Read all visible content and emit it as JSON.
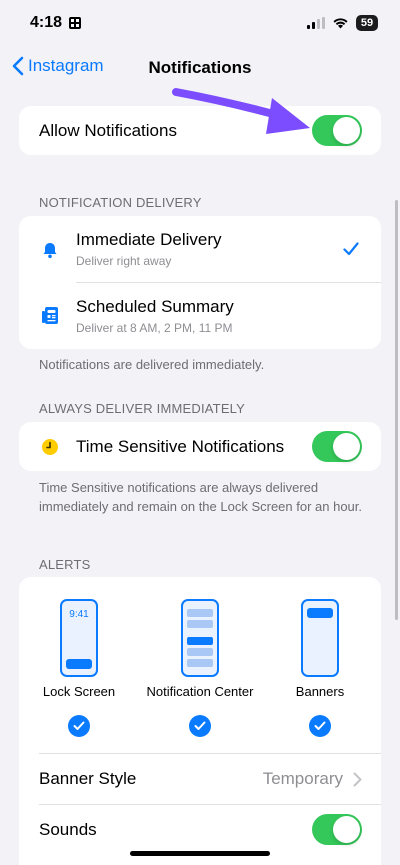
{
  "status_bar": {
    "time": "4:18",
    "battery": "59"
  },
  "nav": {
    "back_label": "Instagram",
    "title": "Notifications"
  },
  "allow": {
    "label": "Allow Notifications",
    "on": true
  },
  "delivery": {
    "header": "NOTIFICATION DELIVERY",
    "items": [
      {
        "label": "Immediate Delivery",
        "sublabel": "Deliver right away",
        "selected": true
      },
      {
        "label": "Scheduled Summary",
        "sublabel": "Deliver at 8 AM, 2 PM, 11 PM",
        "selected": false
      }
    ],
    "footer": "Notifications are delivered immediately."
  },
  "always": {
    "header": "ALWAYS DELIVER IMMEDIATELY",
    "label": "Time Sensitive Notifications",
    "on": true,
    "footer": "Time Sensitive notifications are always delivered immediately and remain on the Lock Screen for an hour."
  },
  "alerts": {
    "header": "ALERTS",
    "items": [
      {
        "label": "Lock Screen",
        "preview_time": "9:41",
        "checked": true
      },
      {
        "label": "Notification Center",
        "checked": true
      },
      {
        "label": "Banners",
        "checked": true
      }
    ],
    "banner_style_label": "Banner Style",
    "banner_style_value": "Temporary",
    "sounds_label": "Sounds",
    "sounds_on": true
  },
  "colors": {
    "accent": "#0A7AFF",
    "toggle_on": "#34C759",
    "annotation_arrow": "#7B4DFF"
  }
}
